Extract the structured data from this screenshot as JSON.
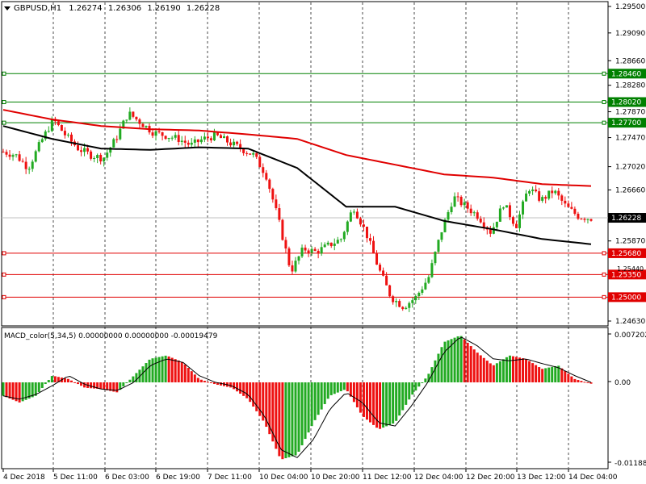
{
  "header": {
    "symbol_timeframe": "GBPUSD,H1",
    "ohlc": [
      "1.26274",
      "1.26306",
      "1.26190",
      "1.26228"
    ]
  },
  "indicator": {
    "label": "MACD_color(5,34,5) 0.00000000 0.00000000 -0.00019479",
    "ticks": [
      "0.0072029",
      "0.00",
      "-0.011884"
    ]
  },
  "price_axis": {
    "ticks": [
      "1.29500",
      "1.29090",
      "1.28660",
      "1.28460",
      "1.28280",
      "1.28020",
      "1.27870",
      "1.27700",
      "1.27470",
      "1.27020",
      "1.26660",
      "1.25870",
      "1.25680",
      "1.25350",
      "1.25000",
      "1.24630",
      "1.25440"
    ],
    "current_price": "1.26228",
    "support_levels": [
      "1.25680",
      "1.25350",
      "1.25000"
    ],
    "resistance_levels": [
      "1.28460",
      "1.28020",
      "1.27700"
    ]
  },
  "time_axis": {
    "labels": [
      "4 Dec 2018",
      "5 Dec 11:00",
      "6 Dec 03:00",
      "6 Dec 19:00",
      "7 Dec 11:00",
      "10 Dec 04:00",
      "10 Dec 20:00",
      "11 Dec 12:00",
      "12 Dec 04:00",
      "12 Dec 20:00",
      "13 Dec 12:00",
      "14 Dec 04:00"
    ]
  },
  "colors": {
    "bull": "#22aa22",
    "bear": "#ee1111",
    "ma_fast": "#e00000",
    "ma_slow": "#000000",
    "support": "#e00000",
    "resistance": "#008000",
    "grid": "#000000"
  },
  "chart_data": {
    "type": "candlestick",
    "symbol": "GBPUSD",
    "timeframe": "H1",
    "candles_count": 140,
    "price_range": [
      1.2463,
      1.295
    ],
    "x_labels": [
      "4 Dec 2018",
      "5 Dec 11:00",
      "6 Dec 03:00",
      "6 Dec 19:00",
      "7 Dec 11:00",
      "10 Dec 04:00",
      "10 Dec 20:00",
      "11 Dec 12:00",
      "12 Dec 04:00",
      "12 Dec 20:00",
      "13 Dec 12:00",
      "14 Dec 04:00"
    ],
    "close_path": [
      1.2725,
      1.272,
      1.27,
      1.274,
      1.2775,
      1.275,
      1.273,
      1.272,
      1.2715,
      1.2745,
      1.2785,
      1.277,
      1.2755,
      1.275,
      1.2745,
      1.2735,
      1.2745,
      1.275,
      1.274,
      1.273,
      1.272,
      1.269,
      1.262,
      1.254,
      1.2575,
      1.257,
      1.258,
      1.259,
      1.264,
      1.26,
      1.2545,
      1.25,
      1.2485,
      1.25,
      1.253,
      1.26,
      1.2655,
      1.264,
      1.2625,
      1.26,
      1.2645,
      1.261,
      1.267,
      1.265,
      1.2665,
      1.264,
      1.2625,
      1.2622
    ],
    "ma_fast_path": [
      1.279,
      1.2775,
      1.2765,
      1.276,
      1.2758,
      1.2752,
      1.2745,
      1.272,
      1.2705,
      1.269,
      1.2685,
      1.2675,
      1.2672
    ],
    "ma_slow_path": [
      1.2765,
      1.2745,
      1.273,
      1.2728,
      1.2732,
      1.273,
      1.27,
      1.264,
      1.264,
      1.2618,
      1.2605,
      1.259,
      1.2582
    ],
    "macd": {
      "range": [
        -0.011884,
        0.0072029
      ],
      "bars": [
        -0.002,
        -0.003,
        -0.002,
        0.001,
        0.0005,
        -0.0008,
        -0.001,
        -0.0015,
        0.001,
        0.0035,
        0.004,
        0.003,
        0.0005,
        -0.0003,
        -0.0008,
        -0.0025,
        -0.006,
        -0.0115,
        -0.0108,
        -0.006,
        -0.002,
        -0.001,
        -0.005,
        -0.007,
        -0.006,
        -0.002,
        0.001,
        0.006,
        0.007,
        0.0045,
        0.0025,
        0.004,
        0.0035,
        0.002,
        0.0025,
        0.0005,
        -0.0002
      ],
      "signal": [
        -0.002,
        -0.0025,
        -0.0018,
        -0.0005,
        0.001,
        -0.0003,
        -0.001,
        -0.0012,
        0.0,
        0.0025,
        0.0035,
        0.003,
        0.001,
        0.0,
        -0.0005,
        -0.0018,
        -0.005,
        -0.01,
        -0.0112,
        -0.0085,
        -0.004,
        -0.0015,
        -0.003,
        -0.006,
        -0.0065,
        -0.0035,
        0.0,
        0.0045,
        0.0068,
        0.0055,
        0.0035,
        0.0032,
        0.0035,
        0.0028,
        0.0022,
        0.001,
        0.0
      ]
    }
  }
}
